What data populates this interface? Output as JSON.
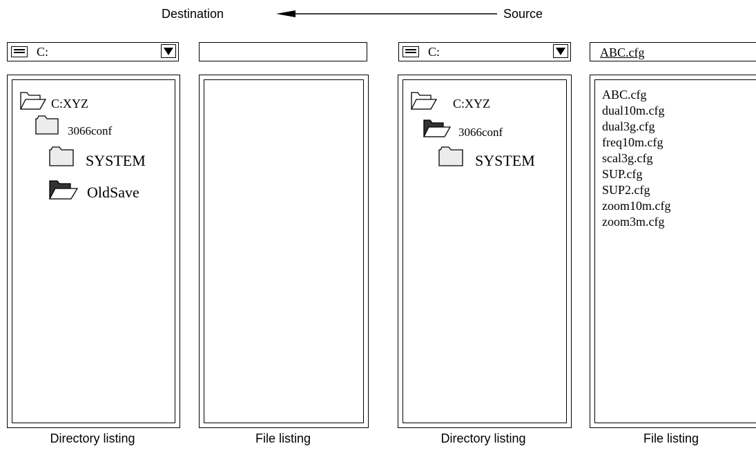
{
  "header": {
    "destination": "Destination",
    "source": "Source"
  },
  "destination": {
    "drive": "C:",
    "filename": "",
    "tree": {
      "root": "C:XYZ",
      "conf": "3066conf",
      "system": "SYSTEM",
      "oldsave": "OldSave"
    },
    "caption_dir": "Directory listing",
    "caption_files": "File listing"
  },
  "source": {
    "drive": "C:",
    "filename": "ABC.cfg",
    "tree": {
      "root": "C:XYZ",
      "conf": "3066conf",
      "system": "SYSTEM"
    },
    "files": [
      "ABC.cfg",
      "dual10m.cfg",
      "dual3g.cfg",
      "freq10m.cfg",
      "scal3g.cfg",
      "SUP.cfg",
      "SUP2.cfg",
      "zoom10m.cfg",
      "zoom3m.cfg"
    ],
    "caption_dir": "Directory listing",
    "caption_files": "File listing"
  },
  "colors": {
    "folder_open_filled": "#333333",
    "folder_fill": "#dddddd",
    "line": "#000000"
  }
}
